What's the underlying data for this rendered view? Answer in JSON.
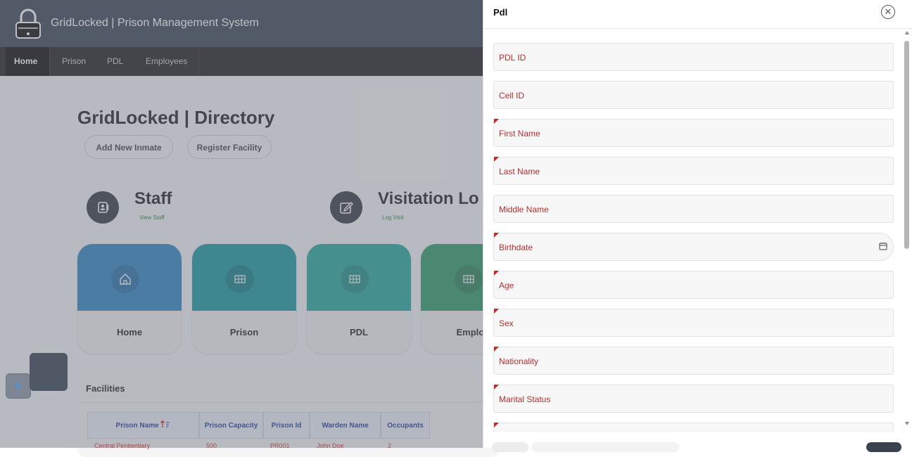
{
  "app": {
    "title": "GridLocked | Prison Management System",
    "nav": [
      {
        "label": "Home",
        "active": true
      },
      {
        "label": "Prison",
        "active": false
      },
      {
        "label": "PDL",
        "active": false
      },
      {
        "label": "Employees",
        "active": false
      }
    ]
  },
  "directory": {
    "title": "GridLocked | Directory",
    "add_inmate_label": "Add New Inmate",
    "register_facility_label": "Register Facility"
  },
  "stats": {
    "staff": {
      "title": "Staff",
      "link": "View Staff"
    },
    "visitation": {
      "title": "Visitation Lo",
      "link": "Log Visit"
    }
  },
  "cards": [
    {
      "label": "Home",
      "color": "#2e84c4",
      "icon": "home-icon"
    },
    {
      "label": "Prison",
      "color": "#17969f",
      "icon": "table-icon"
    },
    {
      "label": "PDL",
      "color": "#23a79b",
      "icon": "table-icon"
    },
    {
      "label": "Employ",
      "color": "#2f9a67",
      "icon": "table-icon"
    }
  ],
  "facilities": {
    "title": "Facilities",
    "columns": [
      "Prison Name",
      "Prison Capacity",
      "Prison Id",
      "Warden Name",
      "Occupants"
    ],
    "sort_icon": "sort-asc-icon",
    "rows": [
      [
        "Central Penitentiary",
        "500",
        "PR001",
        "John Doe",
        "2"
      ]
    ]
  },
  "drawer": {
    "title": "Pdl",
    "fields": [
      {
        "label": "PDL ID",
        "required": false
      },
      {
        "label": "Cell ID",
        "required": false
      },
      {
        "label": "First Name",
        "required": true
      },
      {
        "label": "Last Name",
        "required": true
      },
      {
        "label": "Middle Name",
        "required": false
      },
      {
        "label": "Birthdate",
        "required": true,
        "icon": "calendar-icon"
      },
      {
        "label": "Age",
        "required": true
      },
      {
        "label": "Sex",
        "required": true
      },
      {
        "label": "Nationality",
        "required": true
      },
      {
        "label": "Marital Status",
        "required": true
      }
    ]
  },
  "colors": {
    "header": "#3b4655",
    "nav": "#1f1f1f",
    "label_red": "#b03030",
    "required_marker": "#c62828"
  }
}
